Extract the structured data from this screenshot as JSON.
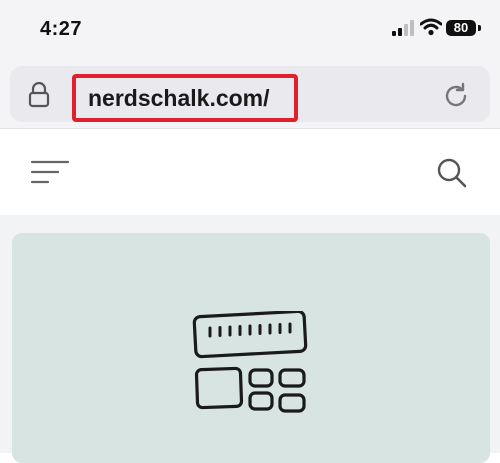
{
  "status_bar": {
    "time": "4:27",
    "battery_level": "80",
    "icons": [
      "cellular-signal-icon",
      "wifi-icon",
      "battery-icon"
    ]
  },
  "browser": {
    "url": "nerdschalk.com/",
    "icons": [
      "lock-icon",
      "reload-icon"
    ],
    "highlight_color": "#e0202a"
  },
  "site_header": {
    "icons": [
      "menu-icon",
      "search-icon"
    ]
  },
  "hero": {
    "icon": "layout-grid-icon",
    "background": "#d7e4e2"
  }
}
